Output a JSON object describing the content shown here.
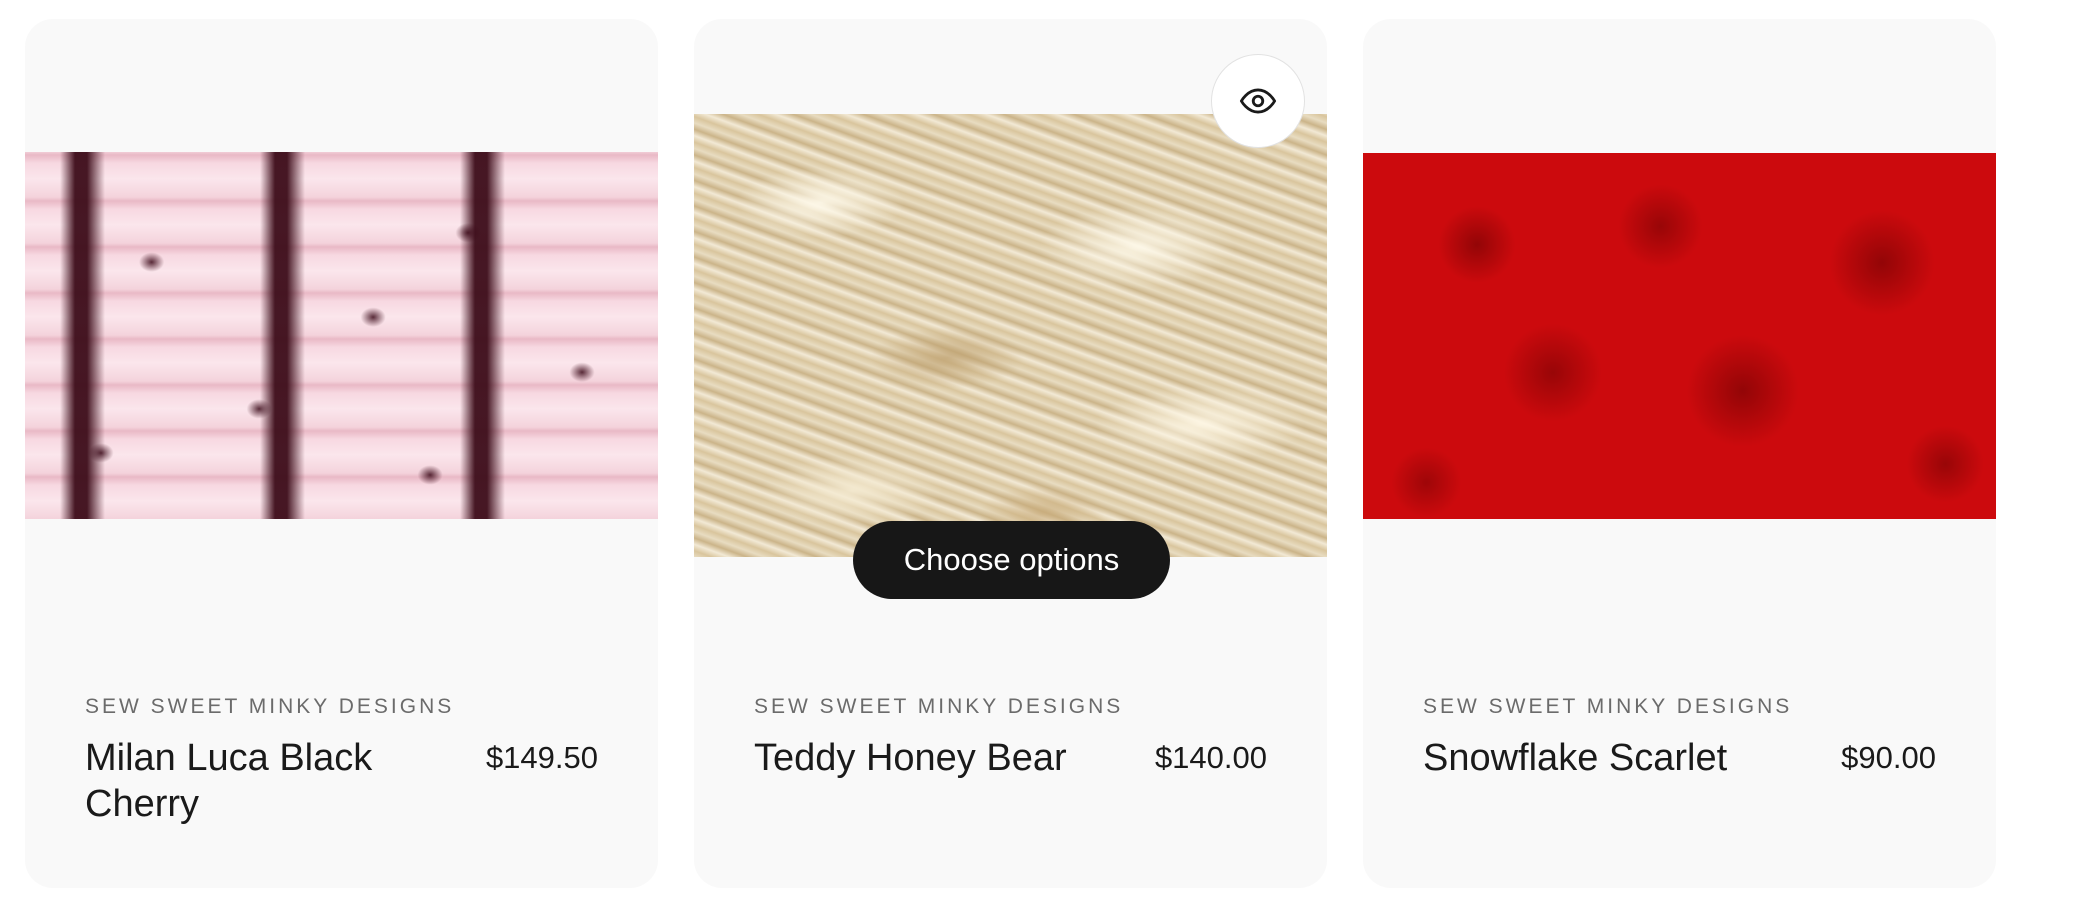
{
  "products": [
    {
      "vendor": "SEW SWEET MINKY DESIGNS",
      "title": "Milan Luca Black Cherry",
      "price": "$149.50",
      "image_alt": "pink and black cherry minky fabric"
    },
    {
      "vendor": "SEW SWEET MINKY DESIGNS",
      "title": "Teddy Honey Bear",
      "price": "$140.00",
      "image_alt": "honey beige faux fur fabric",
      "choose_options_label": "Choose options",
      "quick_view_icon": "eye-icon"
    },
    {
      "vendor": "SEW SWEET MINKY DESIGNS",
      "title": "Snowflake Scarlet",
      "price": "$90.00",
      "image_alt": "red snowflake embossed minky fabric"
    }
  ],
  "colors": {
    "card_bg": "#f9f9f9",
    "button_bg": "#171717",
    "scarlet": "#cc0a0d"
  }
}
